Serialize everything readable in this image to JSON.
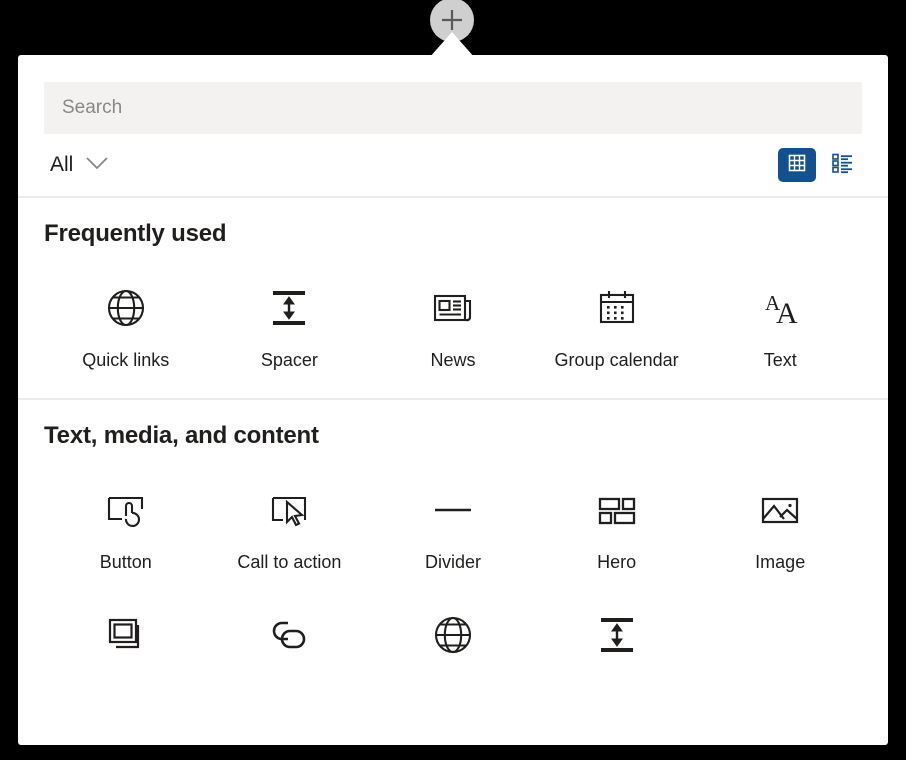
{
  "add_button": {
    "icon": "plus-icon",
    "label": "Add a new web part"
  },
  "search": {
    "placeholder": "Search",
    "value": ""
  },
  "toolbar": {
    "filter_label": "All",
    "filter_icon": "chevron-down-icon",
    "grid_view_label": "Grid view",
    "list_view_label": "List view",
    "grid_view_icon": "grid-icon",
    "list_view_icon": "list-icon",
    "active_view": "grid",
    "accent_color": "#12508f"
  },
  "sections": [
    {
      "title": "Frequently used",
      "items": [
        {
          "label": "Quick links",
          "icon": "globe-icon"
        },
        {
          "label": "Spacer",
          "icon": "spacer-icon"
        },
        {
          "label": "News",
          "icon": "newspaper-icon"
        },
        {
          "label": "Group calendar",
          "icon": "calendar-icon"
        },
        {
          "label": "Text",
          "icon": "text-aa-icon"
        }
      ]
    },
    {
      "title": "Text, media, and content",
      "items": [
        {
          "label": "Button",
          "icon": "button-hand-icon"
        },
        {
          "label": "Call to action",
          "icon": "cursor-box-icon"
        },
        {
          "label": "Divider",
          "icon": "divider-line-icon"
        },
        {
          "label": "Hero",
          "icon": "hero-layout-icon"
        },
        {
          "label": "Image",
          "icon": "image-icon"
        },
        {
          "label": "",
          "icon": "image-gallery-icon"
        },
        {
          "label": "",
          "icon": "link-icon"
        },
        {
          "label": "",
          "icon": "globe-icon"
        },
        {
          "label": "",
          "icon": "spacer-icon"
        }
      ]
    }
  ],
  "colors": {
    "panel_bg": "#ffffff",
    "page_bg": "#000000",
    "search_bg": "#f3f2f1",
    "divider": "#ebebeb",
    "icon": "#201f1e",
    "placeholder": "#8a8886"
  }
}
